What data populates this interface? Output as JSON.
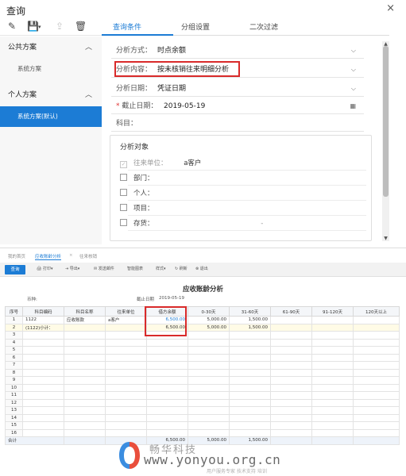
{
  "dialog": {
    "title": "查询",
    "close": "×",
    "tabs": [
      "查询条件",
      "分组设置",
      "二次过滤"
    ],
    "sections": [
      {
        "title": "公共方案",
        "schemes": [
          "系统方案"
        ]
      },
      {
        "title": "个人方案",
        "schemes": [
          "系统方案(默认)"
        ]
      }
    ],
    "fields": {
      "method_label": "分析方式：",
      "method_value": "时点余额",
      "content_label": "分析内容：",
      "content_value": "按未核销往来明细分析",
      "date_label": "分析日期：",
      "date_value": "凭证日期",
      "required_mark": "*",
      "cutoff_label": "截止日期：",
      "cutoff_value": "2019-05-19",
      "subject_label": "科目："
    },
    "group": {
      "title": "分析对象",
      "items": [
        {
          "label": "往来单位：",
          "value": "a客户",
          "checked": true
        },
        {
          "label": "部门：",
          "value": "",
          "checked": false
        },
        {
          "label": "个人：",
          "value": "",
          "checked": false
        },
        {
          "label": "项目：",
          "value": "",
          "checked": false
        },
        {
          "label": "存货：",
          "value": "-",
          "checked": false
        }
      ]
    }
  },
  "report": {
    "tabs": [
      "我的首页",
      "应收账龄分析",
      "往来核销"
    ],
    "toolbar": {
      "query": "查询",
      "print": "打印",
      "export": "导出",
      "send": "发送邮件",
      "chart": "智能图表",
      "style": "样式",
      "refresh": "刷新",
      "exit": "退出"
    },
    "title": "应收账龄分析",
    "currency_label": "币种:",
    "cutoff_label": "截止日期",
    "cutoff_value": "2019-05-19",
    "columns": [
      "序号",
      "科目编码",
      "科目名称",
      "往来单位",
      "借方余额",
      "0-30天",
      "31-60天",
      "61-90天",
      "91-120天",
      "120天以上"
    ],
    "rows": [
      {
        "no": "1",
        "code": "1122",
        "name": "应收账款",
        "unit": "a客户",
        "debit": "6,500.00",
        "d30": "5,000.00",
        "d60": "1,500.00",
        "d90": "",
        "d120": "",
        "over": ""
      },
      {
        "no": "2",
        "code": "(1122)小计：",
        "name": "",
        "unit": "",
        "debit": "6,500.00",
        "d30": "5,000.00",
        "d60": "1,500.00",
        "d90": "",
        "d120": "",
        "over": ""
      }
    ],
    "empty_rows": [
      "3",
      "4",
      "5",
      "6",
      "7",
      "8",
      "9",
      "10",
      "11",
      "12",
      "13",
      "14",
      "15",
      "16"
    ],
    "total": {
      "label": "合计",
      "debit": "6,500.00",
      "d30": "5,000.00",
      "d60": "1,500.00"
    }
  },
  "watermark": {
    "cn": "畅华科技",
    "url": "www.yonyou.org.cn",
    "sub": "用户服务专家 技术支持 培训"
  }
}
